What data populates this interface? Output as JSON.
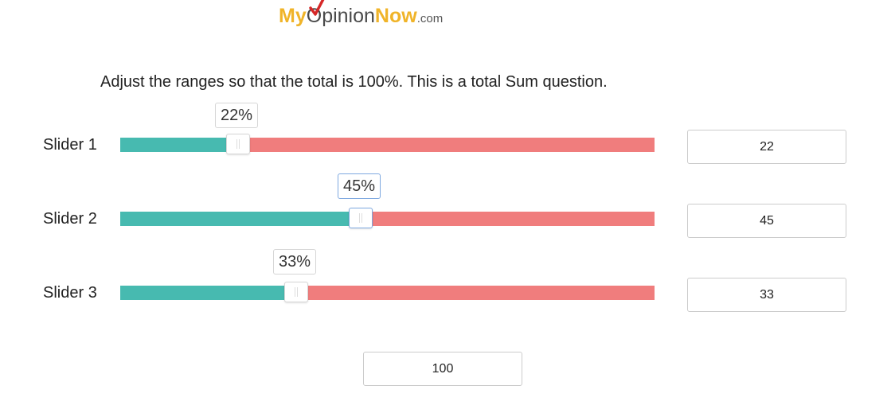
{
  "logo": {
    "part_my": "My",
    "part_o": "O",
    "part_pinion": "pinion",
    "part_now": "Now",
    "part_com": ".com",
    "accent_color": "#f0b429",
    "check_color": "#d62828"
  },
  "question": {
    "text": "Adjust the ranges so that the total is 100%. This is a total Sum question."
  },
  "sliders": [
    {
      "label": "Slider 1",
      "value": 22,
      "tooltip": "22%",
      "input_value": "22",
      "active": false
    },
    {
      "label": "Slider 2",
      "value": 45,
      "tooltip": "45%",
      "input_value": "45",
      "active": true
    },
    {
      "label": "Slider 3",
      "value": 33,
      "tooltip": "33%",
      "input_value": "33",
      "active": false
    }
  ],
  "total": {
    "value": "100"
  },
  "colors": {
    "fill": "#47bab0",
    "track": "#f07d7d",
    "active_border": "#7fa9e0"
  }
}
